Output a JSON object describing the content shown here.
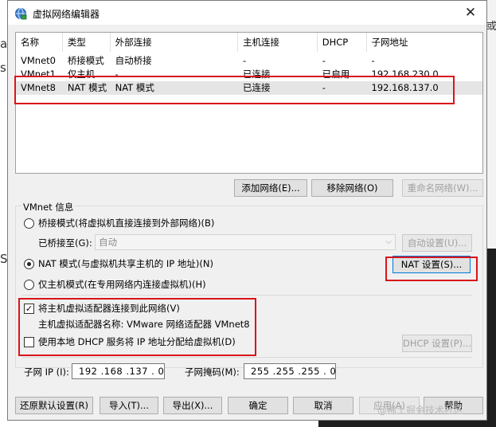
{
  "window": {
    "title": "虚拟网络编辑器",
    "close_glyph": "✕"
  },
  "table": {
    "columns": [
      "名称",
      "类型",
      "外部连接",
      "主机连接",
      "DHCP",
      "子网地址"
    ],
    "rows": [
      [
        "VMnet0",
        "桥接模式",
        "自动桥接",
        "-",
        "-",
        "-"
      ],
      [
        "VMnet1",
        "仅主机...",
        "-",
        "已连接",
        "已启用",
        "192.168.230.0"
      ],
      [
        "VMnet8",
        "NAT 模式",
        "NAT 模式",
        "已连接",
        "-",
        "192.168.137.0"
      ]
    ],
    "selected_row": 2
  },
  "net_buttons": {
    "add": "添加网络(E)...",
    "remove": "移除网络(O)",
    "rename": "重命名网络(W)..."
  },
  "vmnet_info": {
    "group_label": "VMnet 信息",
    "bridged_label": "桥接模式(将虚拟机直接连接到外部网络)(B)",
    "bridged_to_label": "已桥接至(G):",
    "bridged_to_value": "自动",
    "auto_settings": "自动设置(U)...",
    "nat_label": "NAT 模式(与虚拟机共享主机的 IP 地址)(N)",
    "nat_settings": "NAT 设置(S)...",
    "hostonly_label": "仅主机模式(在专用网络内连接虚拟机)(H)",
    "selected_mode": "nat",
    "connect_adapter_label": "将主机虚拟适配器连接到此网络(V)",
    "connect_adapter_checked": true,
    "adapter_name_label": "主机虚拟适配器名称: VMware 网络适配器 VMnet8",
    "dhcp_label": "使用本地 DHCP 服务将 IP 地址分配给虚拟机(D)",
    "dhcp_checked": false,
    "dhcp_settings": "DHCP 设置(P)...",
    "subnet_ip_label": "子网 IP (I):",
    "subnet_ip": "192 .168 .137 . 0",
    "subnet_mask_label": "子网掩码(M):",
    "subnet_mask": "255 .255 .255 . 0"
  },
  "footer": {
    "restore": "还原默认设置(R)",
    "import": "导入(T)...",
    "export": "导出(X)...",
    "ok": "确定",
    "cancel": "取消",
    "apply": "应用(A)",
    "help": "帮助"
  },
  "watermark": "@稀土掘金技术社区",
  "background_fragments": {
    "left_top": "a",
    "left_mid": "s",
    "left_low": "S",
    "right_top": "或"
  },
  "colors": {
    "highlight_box": "#d9141b",
    "focus": "#0078d7"
  }
}
